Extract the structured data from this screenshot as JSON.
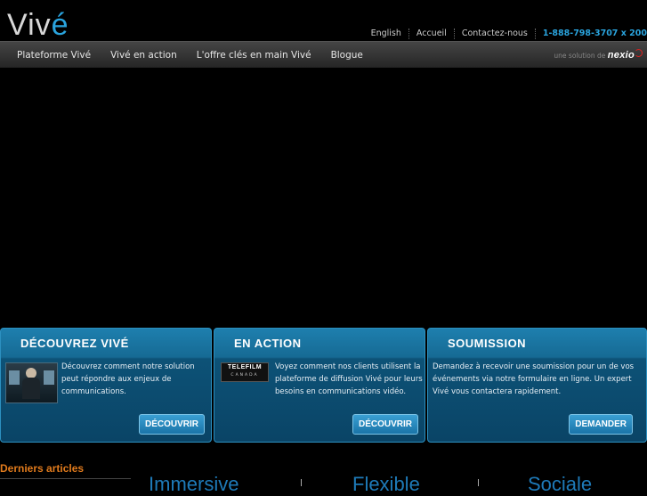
{
  "brand": {
    "logo": "Viv",
    "logo_accent": "é"
  },
  "top_links": [
    "English",
    "Accueil",
    "Contactez-nous"
  ],
  "phone": "1-888-798-3707 x 200",
  "nav": {
    "items": [
      "Plateforme Vivé",
      "Vivé en action",
      "L'offre clés en main Vivé",
      "Blogue"
    ]
  },
  "solution": {
    "prefix": "une solution de",
    "brand": "nexio"
  },
  "panels": [
    {
      "title": "Découvrez Vivé",
      "text": "Découvrez comment notre solution peut répondre aux enjeux de communications.",
      "button": "DÉCOUVRIR"
    },
    {
      "title": "En action",
      "text": "Voyez comment nos clients utilisent la plateforme de diffusion Vivé pour leurs besoins en communications vidéo.",
      "button": "DÉCOUVRIR",
      "logo_line1": "TELEFILM",
      "logo_line2": "CANADA"
    },
    {
      "title": "Soumission",
      "text": "Demandez à recevoir une soumission pour un de vos événements via notre formulaire en ligne.  Un expert Vivé vous contactera rapidement.",
      "button": "DEMANDER"
    }
  ],
  "articles_heading": "Derniers articles",
  "taglines": [
    "Immersive",
    "Flexible",
    "Sociale"
  ]
}
